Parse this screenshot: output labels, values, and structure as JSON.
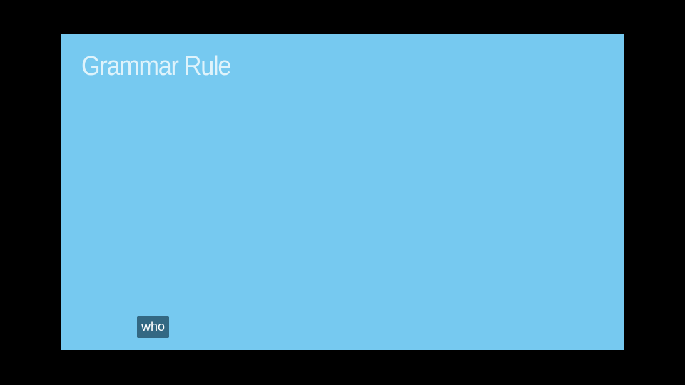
{
  "slide": {
    "title": "Grammar Rule",
    "background_color": "#76c9f0",
    "title_color": "#dff3fb"
  },
  "caption": {
    "text": "who",
    "background_color": "#2e607a",
    "text_color": "#ffffff"
  },
  "frame": {
    "letterbox_color": "#000000"
  }
}
